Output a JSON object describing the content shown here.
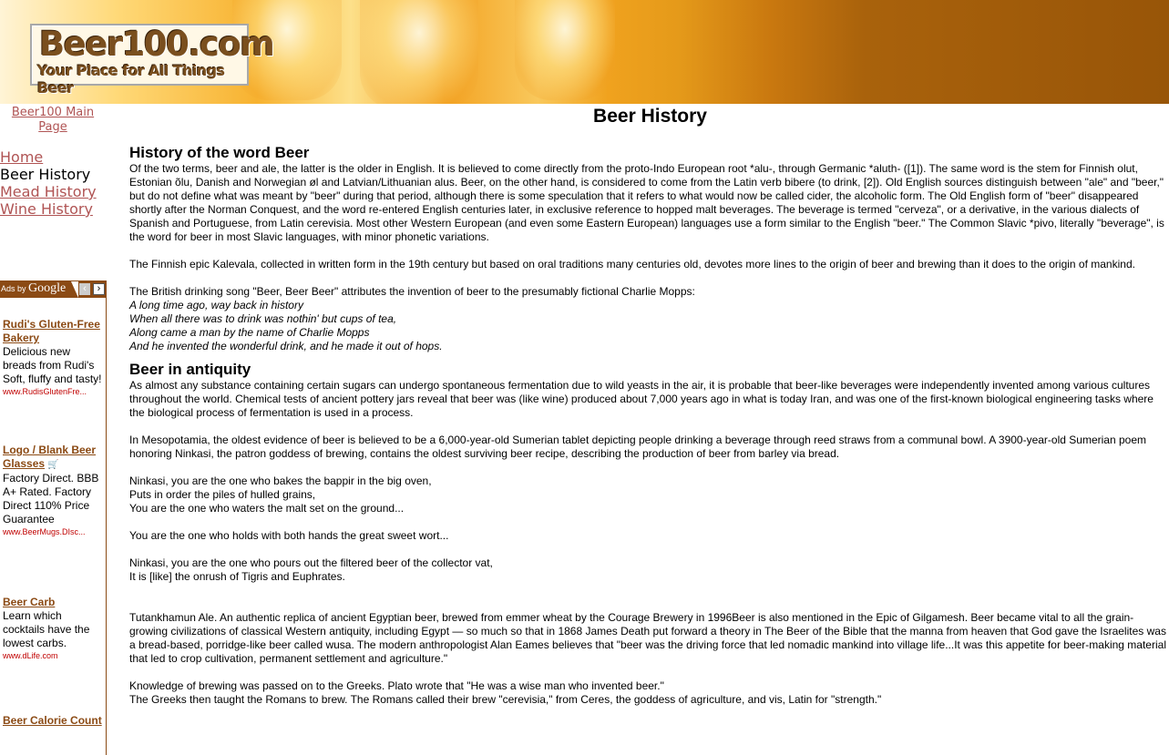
{
  "header": {
    "logo_title": "Beer100.com",
    "logo_tagline": "Your Place for All Things Beer"
  },
  "sidebar": {
    "main_page_link": "Beer100 Main Page",
    "nav": [
      {
        "label": "Home",
        "current": false
      },
      {
        "label": "Beer History",
        "current": true
      },
      {
        "label": "Mead History",
        "current": false
      },
      {
        "label": "Wine History",
        "current": false
      }
    ]
  },
  "ads": {
    "ads_by": "Ads by",
    "google": "Google",
    "items": [
      {
        "title": "Rudi's Gluten-Free Bakery",
        "body": "Delicious new breads from Rudi's Soft, fluffy and tasty!",
        "url": "www.RudisGlutenFre..."
      },
      {
        "title": "Logo / Blank Beer Glasses",
        "body": "Factory Direct. BBB A+ Rated. Factory Direct 110% Price Guarantee",
        "url": "www.BeerMugs.DIsc..."
      },
      {
        "title": "Beer Carb",
        "body": "Learn which cocktails have the lowest carbs.",
        "url": "www.dLife.com"
      },
      {
        "title": "Beer Calorie Count",
        "body": "",
        "url": ""
      }
    ]
  },
  "page": {
    "title": "Beer History",
    "sections": [
      {
        "heading": "History of the word Beer",
        "paragraphs": [
          "Of the two terms, beer and ale, the latter is the older in English. It is believed to come directly from the proto-Indo European root *alu-, through Germanic *aluth- ([1]). The same word is the stem for Finnish olut, Estonian õlu, Danish and Norwegian øl and Latvian/Lithuanian alus. Beer, on the other hand, is considered to come from the Latin verb bibere (to drink, [2]). Old English sources distinguish between \"ale\" and \"beer,\" but do not define what was meant by \"beer\" during that period, although there is some speculation that it refers to what would now be called cider, the alcoholic form. The Old English form of \"beer\" disappeared shortly after the Norman Conquest, and the word re-entered English centuries later, in exclusive reference to hopped malt beverages. The beverage is termed \"cerveza\", or a derivative, in the various dialects of Spanish and Portuguese, from Latin cerevisia. Most other Western European (and even some Eastern European) languages use a form similar to the English \"beer.\" The Common Slavic *pivo, literally \"beverage\", is the word for beer in most Slavic languages, with minor phonetic variations.",
          "The Finnish epic Kalevala, collected in written form in the 19th century but based on oral traditions many centuries old, devotes more lines to the origin of beer and brewing than it does to the origin of mankind.",
          "The British drinking song \"Beer, Beer Beer\" attributes the invention of beer to the presumably fictional Charlie Mopps:"
        ],
        "verse": [
          "A long time ago, way back in history",
          "When all there was to drink was nothin' but cups of tea,",
          "Along came a man by the name of Charlie Mopps",
          "And he invented the wonderful drink, and he made it out of hops."
        ]
      },
      {
        "heading": "Beer in antiquity",
        "paragraphs": [
          "As almost any substance containing certain sugars can undergo spontaneous fermentation due to wild yeasts in the air, it is probable that beer-like beverages were independently invented among various cultures throughout the world. Chemical tests of ancient pottery jars reveal that beer was (like wine) produced about 7,000 years ago in what is today Iran, and was one of the first-known biological engineering tasks where the biological process of fermentation is used in a process.",
          "In Mesopotamia, the oldest evidence of beer is believed to be a 6,000-year-old Sumerian tablet depicting people drinking a beverage through reed straws from a communal bowl. A 3900-year-old Sumerian poem honoring Ninkasi, the patron goddess of brewing, contains the oldest surviving beer recipe, describing the production of beer from barley via bread."
        ],
        "poem": [
          [
            "Ninkasi, you are the one who bakes the bappir in the big oven,",
            "Puts in order the piles of hulled grains,",
            "You are the one who waters the malt set on the ground..."
          ],
          [
            "You are the one who holds with both hands the great sweet wort..."
          ],
          [
            "Ninkasi, you are the one who pours out the filtered beer of the collector vat,",
            "It is [like] the onrush of Tigris and Euphrates."
          ]
        ],
        "closing": [
          "Tutankhamun Ale. An authentic replica of ancient Egyptian beer, brewed from emmer wheat by the Courage Brewery in 1996Beer is also mentioned in the Epic of Gilgamesh. Beer became vital to all the grain-growing civilizations of classical Western antiquity, including Egypt — so much so that in 1868 James Death put forward a theory in The Beer of the Bible that the manna from heaven that God gave the Israelites was a bread-based, porridge-like beer called wusa. The modern anthropologist Alan Eames believes that \"beer was the driving force that led nomadic mankind into village life...It was this appetite for beer-making material that led to crop cultivation, permanent settlement and agriculture.\"",
          "Knowledge of brewing was passed on to the Greeks. Plato wrote that \"He was a wise man who invented beer.\"",
          "The Greeks then taught the Romans to brew. The Romans called their brew \"cerevisia,\" from Ceres, the goddess of agriculture, and vis, Latin for \"strength.\""
        ]
      }
    ]
  }
}
